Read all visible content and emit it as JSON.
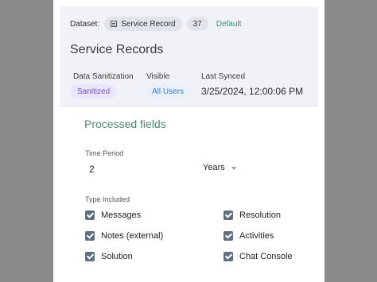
{
  "dataset": {
    "label": "Dataset:",
    "chip_label": "Service Record",
    "count": "37",
    "status": "Default"
  },
  "header": {
    "title": "Service Records",
    "sanitization_label": "Data Sanitization",
    "sanitization_value": "Sanitized",
    "visible_label": "Visible",
    "visible_value": "All Users",
    "synced_label": "Last Synced",
    "synced_value": "3/25/2024, 12:00:06 PM"
  },
  "processed": {
    "title": "Processed fields",
    "time_period_label": "Time Period",
    "time_period_value": "2",
    "time_unit": "Years",
    "type_label": "Type Included",
    "types": [
      {
        "label": "Messages",
        "checked": true
      },
      {
        "label": "Resolution",
        "checked": true
      },
      {
        "label": "Notes (external)",
        "checked": true
      },
      {
        "label": "Activities",
        "checked": true
      },
      {
        "label": "Solution",
        "checked": true
      },
      {
        "label": "Chat Console",
        "checked": true
      }
    ]
  }
}
